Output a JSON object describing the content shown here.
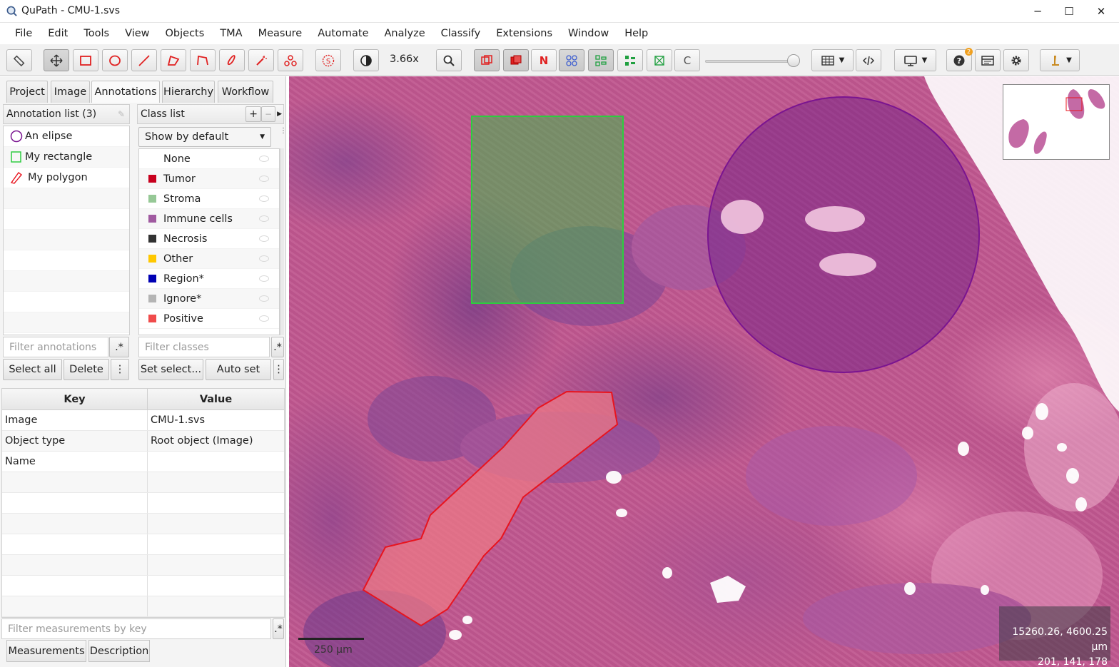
{
  "window": {
    "title": "QuPath - CMU-1.svs",
    "minimize": "─",
    "maximize": "☐",
    "close": "✕"
  },
  "menu": [
    "File",
    "Edit",
    "Tools",
    "View",
    "Objects",
    "TMA",
    "Measure",
    "Automate",
    "Analyze",
    "Classify",
    "Extensions",
    "Window",
    "Help"
  ],
  "toolbar": {
    "zoom": "3.66x",
    "brightness_icon": "contrast-icon",
    "counter_label": "N",
    "channel_label": "C",
    "notification_badge": "2"
  },
  "tabs": [
    "Project",
    "Image",
    "Annotations",
    "Hierarchy",
    "Workflow"
  ],
  "annotations": {
    "header": "Annotation list (3)",
    "items": [
      {
        "label": "An elipse",
        "icon": "ellipse-icon"
      },
      {
        "label": "My rectangle",
        "icon": "rectangle-icon"
      },
      {
        "label": "My polygon",
        "icon": "polygon-icon"
      }
    ],
    "filter_placeholder": "Filter annotations",
    "regex_label": ".*",
    "select_all": "Select all",
    "delete": "Delete",
    "more": "⋮"
  },
  "classes": {
    "header": "Class list",
    "add": "+",
    "remove": "−",
    "dropdown": "Show by default",
    "items": [
      {
        "label": "None",
        "color": ""
      },
      {
        "label": "Tumor",
        "color": "#c8001e"
      },
      {
        "label": "Stroma",
        "color": "#96c896"
      },
      {
        "label": "Immune cells",
        "color": "#a05aa0"
      },
      {
        "label": "Necrosis",
        "color": "#323232"
      },
      {
        "label": "Other",
        "color": "#ffc800"
      },
      {
        "label": "Region*",
        "color": "#0000b4"
      },
      {
        "label": "Ignore*",
        "color": "#b4b4b4"
      },
      {
        "label": "Positive",
        "color": "#f04b4b"
      }
    ],
    "filter_placeholder": "Filter classes",
    "regex_label": ".*",
    "set_selected": "Set select...",
    "auto_set": "Auto set",
    "more": "⋮"
  },
  "measurements": {
    "columns": [
      "Key",
      "Value"
    ],
    "rows": [
      {
        "key": "Image",
        "value": "CMU-1.svs"
      },
      {
        "key": "Object type",
        "value": "Root object (Image)"
      },
      {
        "key": "Name",
        "value": ""
      }
    ],
    "filter_placeholder": "Filter measurements by key",
    "regex_label": ".*",
    "tabs": [
      "Measurements",
      "Description"
    ]
  },
  "viewer": {
    "coords_line1": "15260.26, 4600.25 µm",
    "coords_line2": "201, 141, 178",
    "scalebar": "250 µm",
    "rectangle_color": "#2ecc40",
    "ellipse_color": "#7a1490",
    "polygon_color": "#e8141e"
  }
}
